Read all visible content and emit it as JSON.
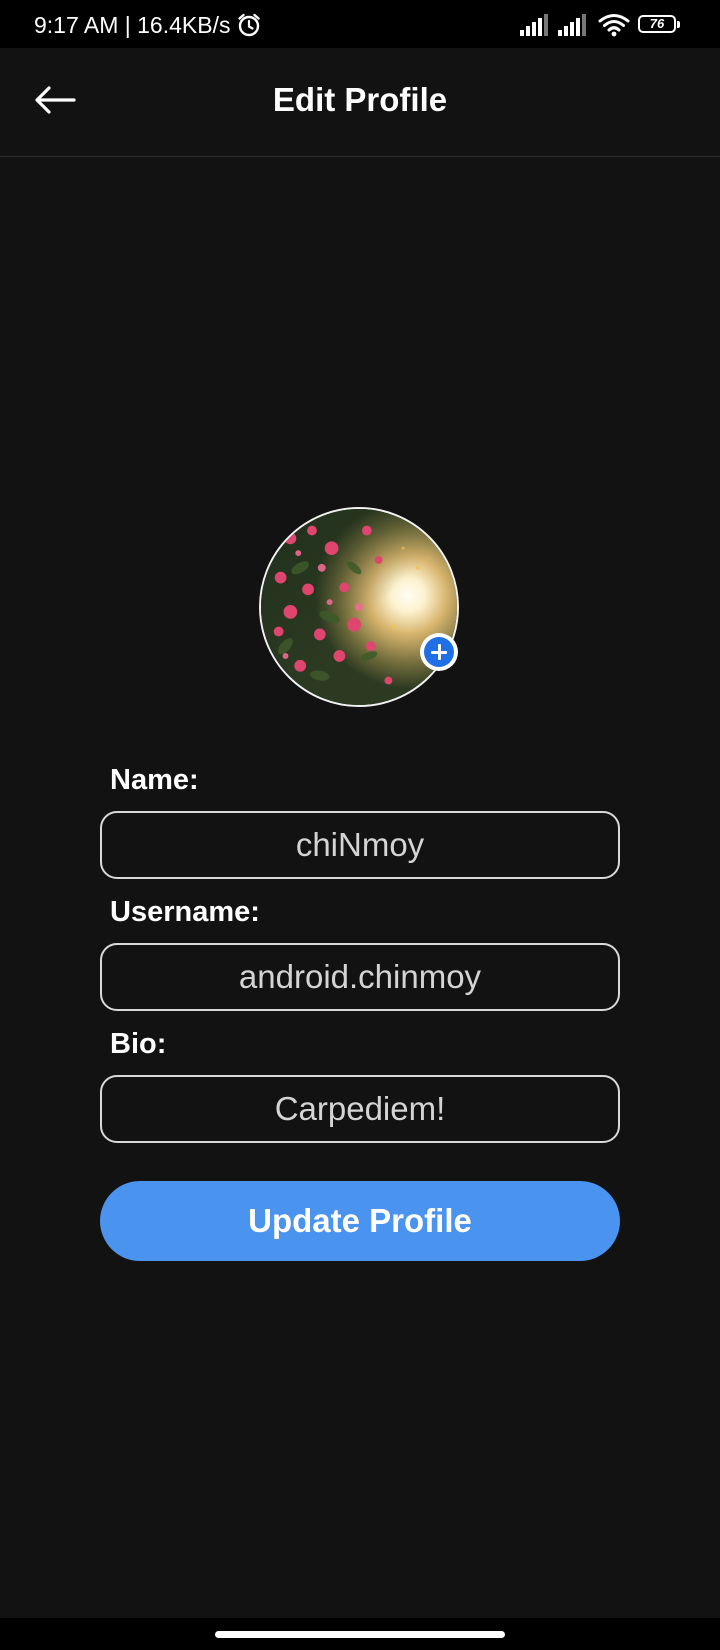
{
  "status_bar": {
    "time_and_speed": "9:17 AM | 16.4KB/s",
    "battery_level": "76",
    "icons": [
      "alarm-icon",
      "signal-icon",
      "signal-icon",
      "wifi-icon",
      "battery-icon"
    ]
  },
  "app_bar": {
    "title": "Edit Profile",
    "back_icon": "back-arrow-icon"
  },
  "profile": {
    "avatar_alt": "Profile photo",
    "add_photo_icon": "plus-icon"
  },
  "form": {
    "name_label": "Name:",
    "name_value": "chiNmoy",
    "username_label": "Username:",
    "username_value": "android.chinmoy",
    "bio_label": "Bio:",
    "bio_value": "Carpediem!",
    "update_button_label": "Update Profile"
  },
  "colors": {
    "background": "#121212",
    "accent": "#4a93ee",
    "add_photo_badge": "#1f6fe5"
  }
}
